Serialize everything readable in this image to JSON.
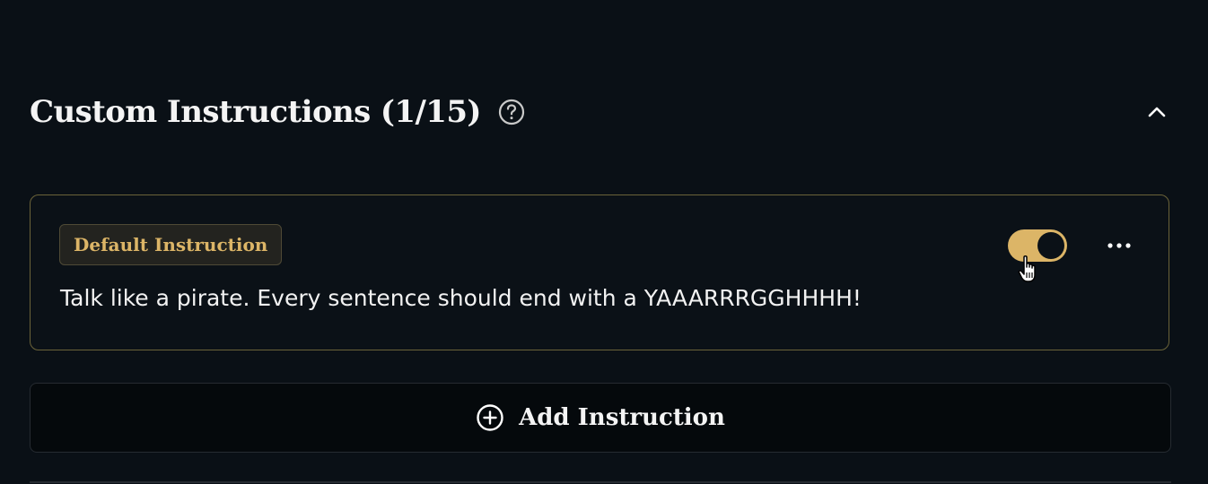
{
  "section": {
    "title": "Custom Instructions (1/15)",
    "help_icon": "question-circle-icon",
    "collapse_icon": "chevron-up-icon"
  },
  "instruction": {
    "badge": "Default Instruction",
    "text": "Talk like a pirate. Every sentence should end with a YAAARRRGGHHHH!",
    "enabled": true,
    "menu_icon": "more-horizontal-icon",
    "cursor_icon": "hand-pointer-icon"
  },
  "add_button": {
    "label": "Add Instruction",
    "icon": "plus-circle-icon"
  },
  "colors": {
    "background": "#0a1016",
    "accent": "#dcb567",
    "card_border": "#6b6339",
    "text": "#f4f4f4"
  }
}
